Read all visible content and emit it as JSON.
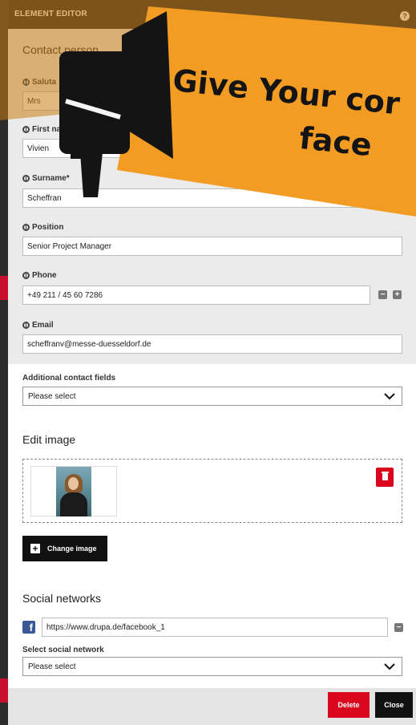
{
  "editor": {
    "title": "ELEMENT EDITOR",
    "help_icon": "help-icon"
  },
  "promo": {
    "line1": "Give Your cor",
    "line2": "face",
    "colors": {
      "banner": "#f39c24",
      "banner_dark": "#c97d14",
      "ink": "#141414"
    },
    "icon": "megaphone-icon"
  },
  "contact": {
    "section_title": "Contact person",
    "salutation": {
      "label": "Saluta",
      "value": "Mrs"
    },
    "first_name": {
      "label": "First nam",
      "value": "Vivien"
    },
    "surname": {
      "label": "Surname*",
      "value": "Scheffran"
    },
    "position": {
      "label": "Position",
      "value": "Senior Project Manager"
    },
    "phone": {
      "label": "Phone",
      "value": "+49 211 / 45 60 7286"
    },
    "email": {
      "label": "Email",
      "value": "scheffranv@messe-duesseldorf.de"
    }
  },
  "additional": {
    "label": "Additional contact fields",
    "selected": "Please select"
  },
  "image": {
    "section_title": "Edit image",
    "change_label": "Change image"
  },
  "social": {
    "section_title": "Social networks",
    "url_value": "https://www.drupa.de/facebook_1",
    "select_label": "Select social network",
    "selected": "Please select"
  },
  "footer": {
    "delete_label": "Delete",
    "close_label": "Close"
  },
  "colors": {
    "accent_red": "#d9061d",
    "dark": "#111111",
    "panel_gray": "#ebebeb"
  }
}
